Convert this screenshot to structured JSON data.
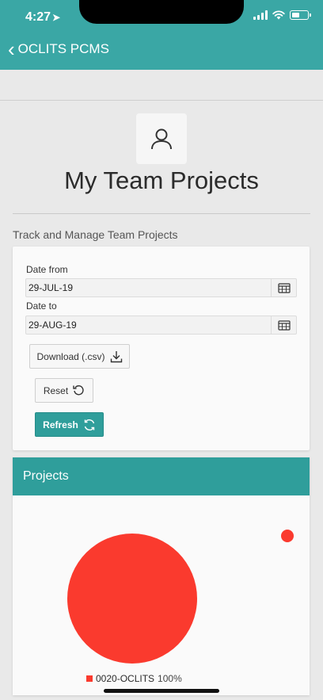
{
  "status_bar": {
    "time": "4:27"
  },
  "nav": {
    "back_label": "OCLITS PCMS"
  },
  "page": {
    "title": "My Team Projects",
    "subtitle": "Track and Manage Team Projects"
  },
  "form": {
    "date_from_label": "Date from",
    "date_from_value": "29-JUL-19",
    "date_to_label": "Date to",
    "date_to_value": "29-AUG-19",
    "download_label": "Download (.csv)",
    "reset_label": "Reset",
    "refresh_label": "Refresh"
  },
  "projects": {
    "header": "Projects"
  },
  "colors": {
    "accent": "#3aa7a5",
    "pie": "#fa3a2e"
  },
  "chart_data": {
    "type": "pie",
    "slices": [
      {
        "label": "0020-OCLITS",
        "value": 100,
        "display": "100%"
      }
    ]
  }
}
